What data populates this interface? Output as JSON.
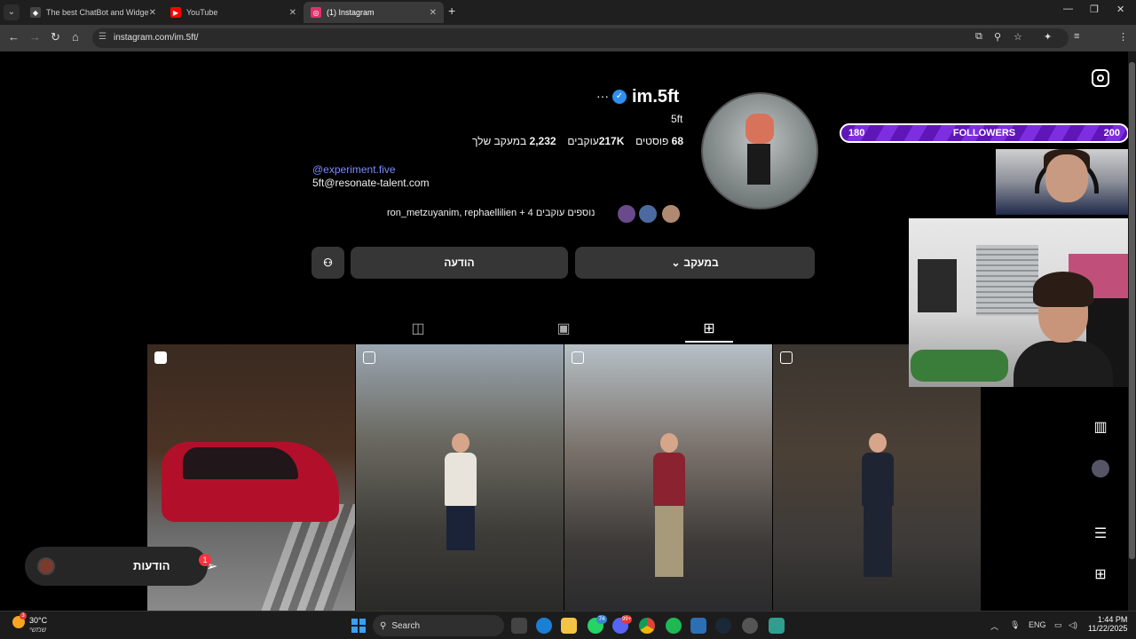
{
  "browser": {
    "tabs": [
      {
        "title": "The best ChatBot and Widgets",
        "active": false,
        "favicon_color": "#cfcfcf"
      },
      {
        "title": "YouTube",
        "active": false,
        "favicon_color": "#ff0000"
      },
      {
        "title": "(1) Instagram",
        "active": true,
        "favicon_color": "#e1306c"
      }
    ],
    "url": "instagram.com/im.5ft/",
    "profile_initial": "G"
  },
  "profile": {
    "username": "im.5ft",
    "full_name": "5ft",
    "stats": {
      "posts_count": "68",
      "posts_label": "פוסטים",
      "followers_count": "217K",
      "followers_label": "עוקבים",
      "following_count": "2,232",
      "following_label": "במעקב שלך"
    },
    "bio_link": "@experiment.five",
    "bio_email": "5ft@resonate-talent.com",
    "mutual_followers": "ron_metzuyanim, rephaellilien + 4 נוספים עוקבים",
    "buttons": {
      "following": "במעקב",
      "message": "הודעה"
    }
  },
  "tabs_icons": [
    "tagged-icon",
    "reels-icon",
    "grid-icon"
  ],
  "posts": [
    {
      "type": "reel",
      "scene": "car"
    },
    {
      "type": "carousel",
      "scene": "alley"
    },
    {
      "type": "carousel",
      "scene": "street"
    },
    {
      "type": "carousel",
      "scene": "bridge"
    }
  ],
  "overlay": {
    "follower_goal": {
      "current": "180",
      "label": "FOLLOWERS",
      "goal": "200"
    }
  },
  "notifications": {
    "label": "הודעות",
    "count": "1"
  },
  "taskbar": {
    "weather_temp": "30°C",
    "weather_desc": "שמשי",
    "weather_badge": "3",
    "search_placeholder": "Search",
    "whatsapp_badge": "74",
    "discord_badge": "99+",
    "language": "ENG",
    "time": "1:44 PM",
    "date": "11/22/2025"
  },
  "colors": {
    "accent": "#0095f6",
    "link": "#7c8cff",
    "overlay_purple": "#6a1fcf"
  }
}
